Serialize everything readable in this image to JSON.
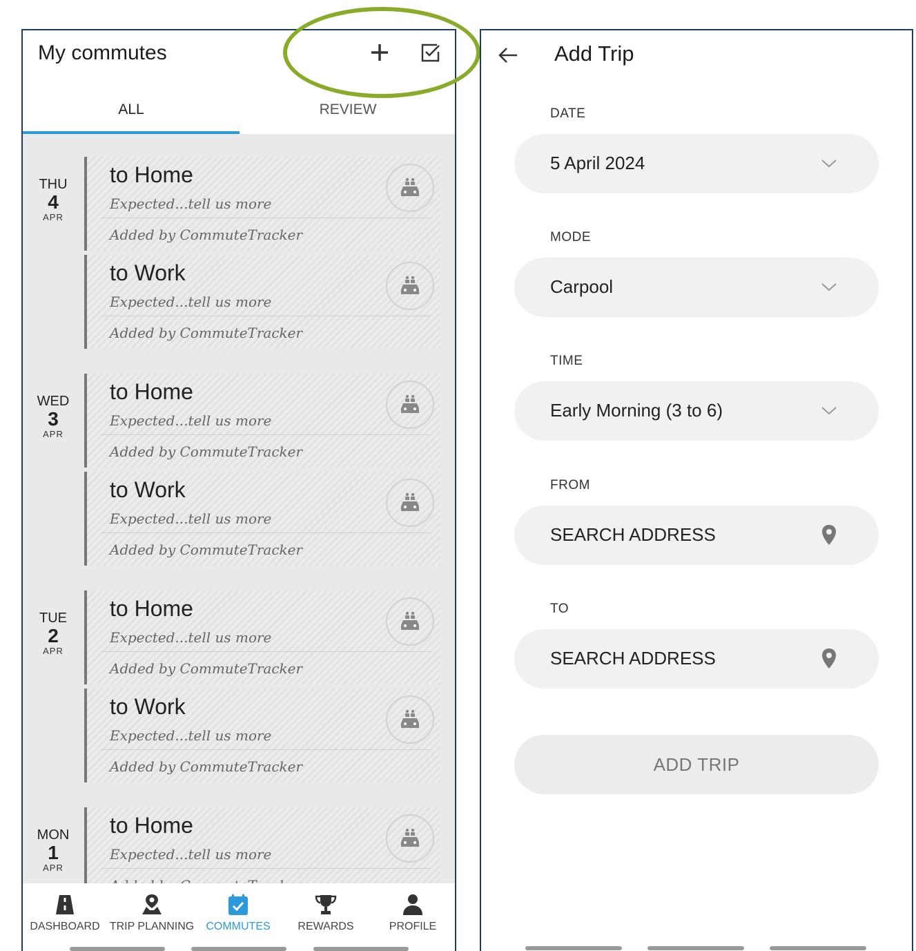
{
  "commutes": {
    "title": "My commutes",
    "tabs": {
      "all": "ALL",
      "review": "REVIEW"
    },
    "days": [
      {
        "dow": "THU",
        "num": "4",
        "mon": "APR",
        "trips": [
          {
            "title": "to Home",
            "subtitle": "Expected...tell us more",
            "added": "Added by CommuteTracker"
          },
          {
            "title": "to Work",
            "subtitle": "Expected...tell us more",
            "added": "Added by CommuteTracker"
          }
        ]
      },
      {
        "dow": "WED",
        "num": "3",
        "mon": "APR",
        "trips": [
          {
            "title": "to Home",
            "subtitle": "Expected...tell us more",
            "added": "Added by CommuteTracker"
          },
          {
            "title": "to Work",
            "subtitle": "Expected...tell us more",
            "added": "Added by CommuteTracker"
          }
        ]
      },
      {
        "dow": "TUE",
        "num": "2",
        "mon": "APR",
        "trips": [
          {
            "title": "to Home",
            "subtitle": "Expected...tell us more",
            "added": "Added by CommuteTracker"
          },
          {
            "title": "to Work",
            "subtitle": "Expected...tell us more",
            "added": "Added by CommuteTracker"
          }
        ]
      },
      {
        "dow": "MON",
        "num": "1",
        "mon": "APR",
        "trips": [
          {
            "title": "to Home",
            "subtitle": "Expected...tell us more",
            "added": "Added by CommuteTracker"
          }
        ]
      }
    ],
    "nav": [
      {
        "label": "DASHBOARD",
        "icon": "road-icon"
      },
      {
        "label": "TRIP PLANNING",
        "icon": "map-pin-icon"
      },
      {
        "label": "COMMUTES",
        "icon": "calendar-check-icon",
        "active": true
      },
      {
        "label": "REWARDS",
        "icon": "trophy-icon"
      },
      {
        "label": "PROFILE",
        "icon": "person-icon"
      }
    ]
  },
  "add_trip": {
    "title": "Add Trip",
    "date": {
      "label": "DATE",
      "value": "5 April 2024"
    },
    "mode": {
      "label": "MODE",
      "value": "Carpool"
    },
    "time": {
      "label": "TIME",
      "value": "Early Morning (3 to 6)"
    },
    "from": {
      "label": "FROM",
      "value": "SEARCH ADDRESS"
    },
    "to": {
      "label": "TO",
      "value": "SEARCH ADDRESS"
    },
    "button": "ADD TRIP"
  },
  "colors": {
    "accent": "#2c9ad8",
    "frame": "#1d3e5c",
    "annotation": "#8aab2a"
  }
}
